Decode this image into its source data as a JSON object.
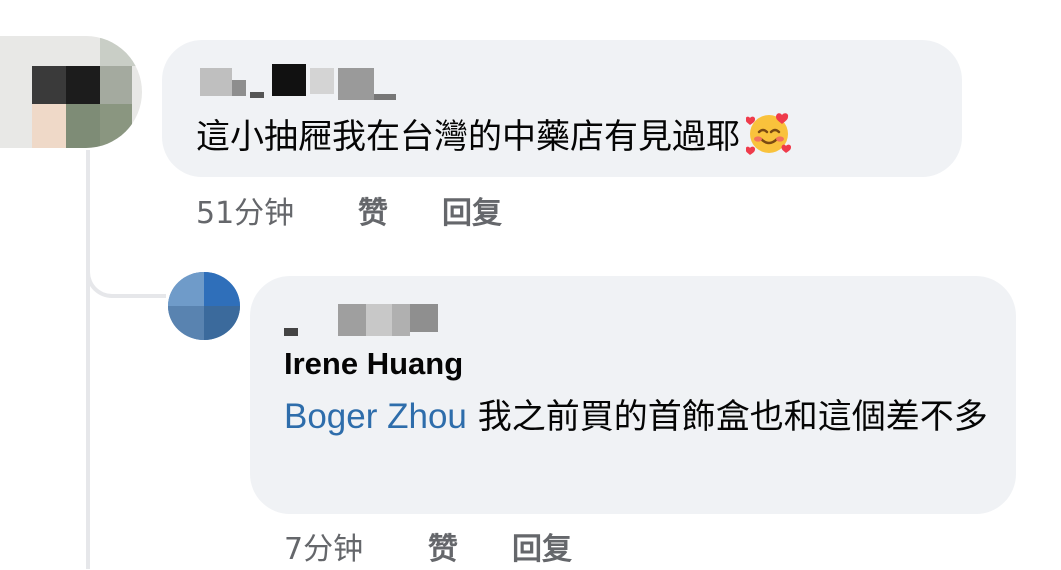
{
  "comments": [
    {
      "text": "這小抽屜我在台灣的中藥店有見過耶",
      "emoji": "smiling-face-with-hearts-icon",
      "time": "51分钟",
      "like_label": "赞",
      "reply_label": "回复"
    }
  ],
  "reply": {
    "author": "Irene Huang",
    "mention": "Boger Zhou",
    "text": "我之前買的首飾盒也和這個差不多",
    "time": "7分钟",
    "like_label": "赞",
    "reply_label": "回复"
  },
  "colors": {
    "bubble": "#f0f2f5",
    "meta_text": "#65676b",
    "mention_link": "#2e6dab",
    "thread_line": "#e6e7ea"
  }
}
